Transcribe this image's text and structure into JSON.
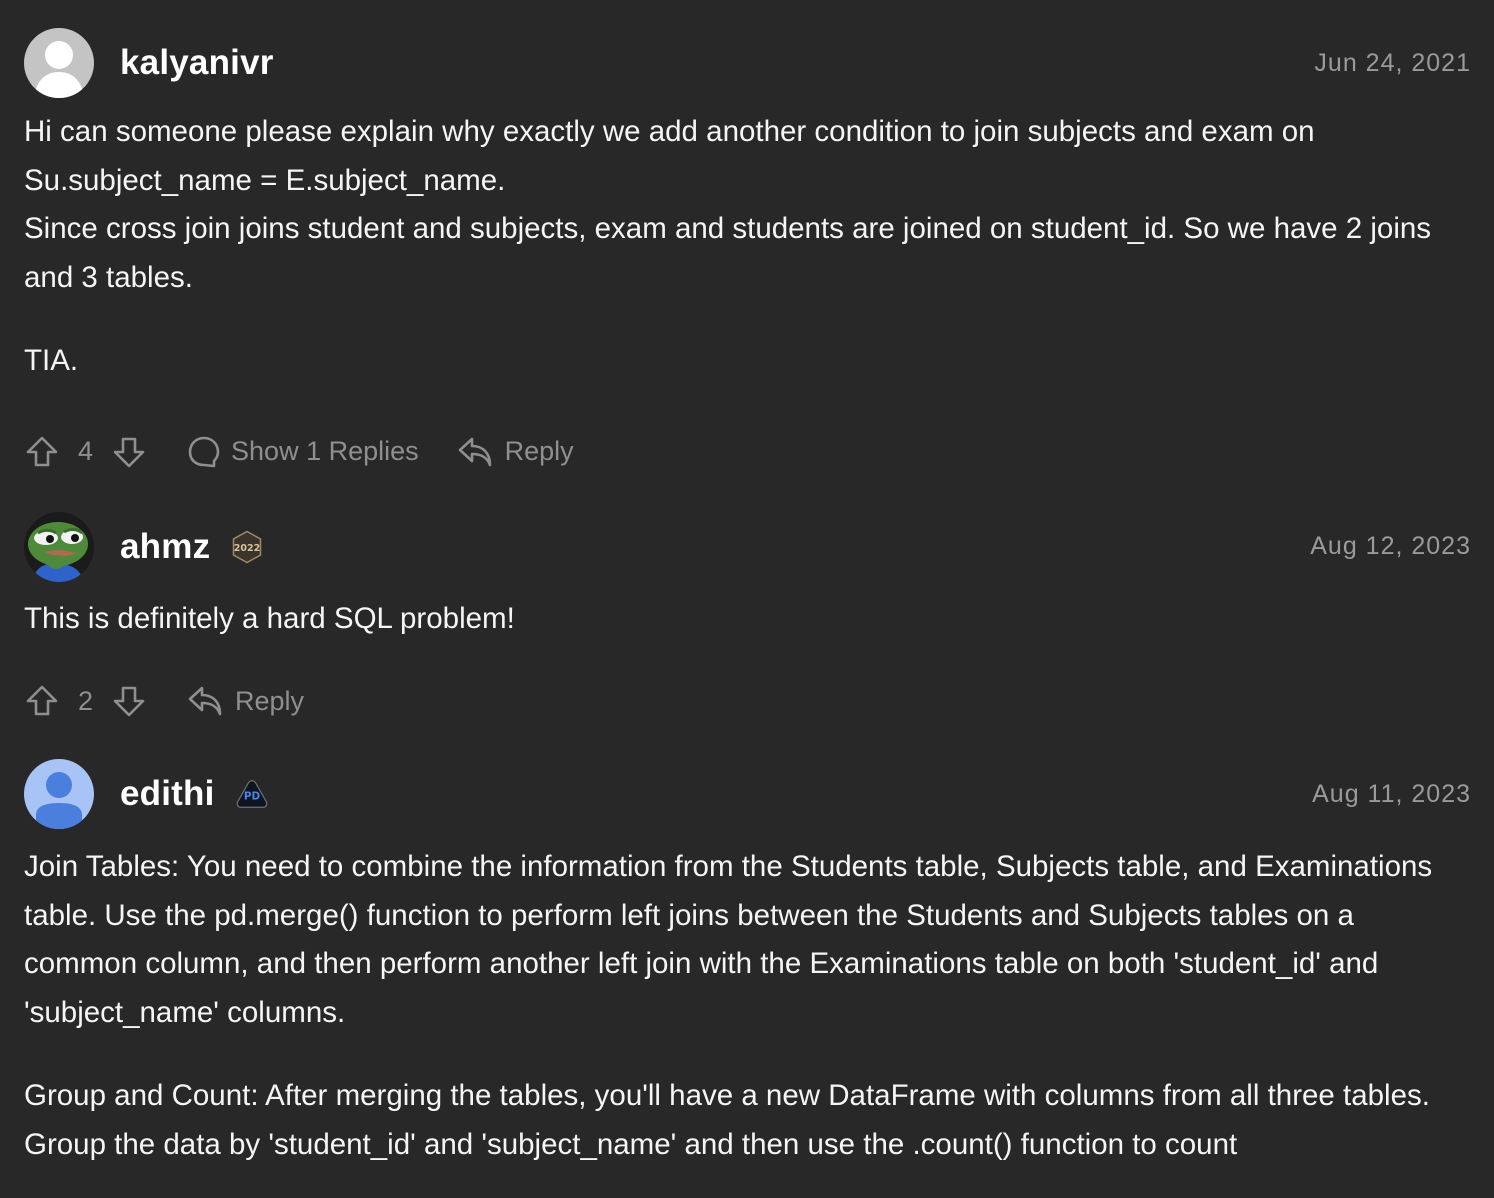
{
  "comments": [
    {
      "username": "kalyanivr",
      "avatar": "default-gray-avatar",
      "badge": null,
      "date": "Jun 24, 2021",
      "paragraphs": [
        "Hi can someone please explain why exactly we add another condition to join subjects and exam on Su.subject_name = E.subject_name.\nSince cross join joins student and subjects, exam and students are joined on student_id. So we have 2 joins and 3 tables.",
        "TIA."
      ],
      "votes": "4",
      "show_replies_label": "Show 1 Replies",
      "reply_label": "Reply"
    },
    {
      "username": "ahmz",
      "avatar": "pepe-frog-avatar",
      "badge": "2022-annual-badge",
      "badge_text": "2022",
      "date": "Aug 12, 2023",
      "paragraphs": [
        "This is definitely a hard SQL problem!"
      ],
      "votes": "2",
      "reply_label": "Reply"
    },
    {
      "username": "edithi",
      "avatar": "default-blue-avatar",
      "badge": "pd-badge",
      "badge_text": "PD",
      "date": "Aug 11, 2023",
      "paragraphs": [
        "Join Tables: You need to combine the information from the Students table, Subjects table, and Examinations table. Use the pd.merge() function to perform left joins between the Students and Subjects tables on a common column, and then perform another left join with the Examinations table on both 'student_id' and 'subject_name' columns.",
        "Group and Count: After merging the tables, you'll have a new DataFrame with columns from all three tables. Group the data by 'student_id' and 'subject_name' and then use the .count() function to count"
      ]
    }
  ],
  "colors": {
    "background": "#282828",
    "text": "#f5f5f5",
    "muted": "#8f8f8f",
    "date": "#9a9a9a"
  }
}
